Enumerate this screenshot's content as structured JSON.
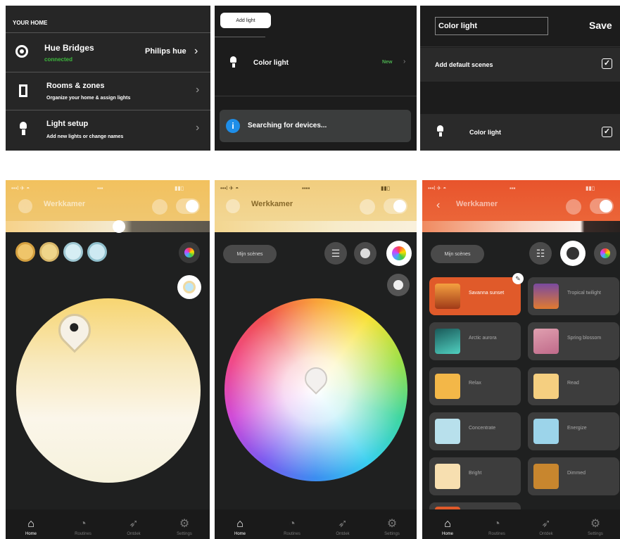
{
  "panel1": {
    "section_title": "YOUR HOME",
    "bridge": {
      "title": "Hue Bridges",
      "status": "connected",
      "value": "Philips hue"
    },
    "rooms": {
      "title": "Rooms & zones",
      "subtitle": "Organize your home & assign lights"
    },
    "light_setup": {
      "title": "Light setup",
      "subtitle": "Add new lights or change names"
    }
  },
  "panel2": {
    "add_light_label": "Add light",
    "light_name": "Color light",
    "light_badge": "New",
    "searching_text": "Searching for devices..."
  },
  "panel3": {
    "name_input_value": "Color light",
    "save_label": "Save",
    "default_scenes_label": "Add default scenes",
    "light_name": "Color light"
  },
  "phones": {
    "room_title": "Werkkamer",
    "my_scenes_label": "Mijn scènes",
    "nav": {
      "home": "Home",
      "routines": "Routines",
      "explore": "Ontdek",
      "settings": "Settings"
    }
  },
  "phone3": {
    "scenes": [
      {
        "label": "Savanna sunset"
      },
      {
        "label": "Tropical twilight"
      },
      {
        "label": "Arctic aurora"
      },
      {
        "label": "Spring blossom"
      },
      {
        "label": "Relax"
      },
      {
        "label": "Read"
      },
      {
        "label": "Concentrate"
      },
      {
        "label": "Energize"
      },
      {
        "label": "Bright"
      },
      {
        "label": "Dimmed"
      }
    ]
  },
  "colors": {
    "panel_dark": "#262626",
    "divider": "#555555",
    "connected_green": "#3db83d",
    "new_green": "#4caf50",
    "info_blue": "#1e8ee8",
    "warm_header": "#f0c36e",
    "pale_header": "#f3d792",
    "orange_header": "#e8542c",
    "scene_selected": "#e05a2a"
  },
  "icons": {
    "bridge": "bridge-icon",
    "rooms": "door-icon",
    "light_setup": "bulb-icon",
    "info": "info-icon",
    "checkbox": "checkbox-checked-icon"
  }
}
